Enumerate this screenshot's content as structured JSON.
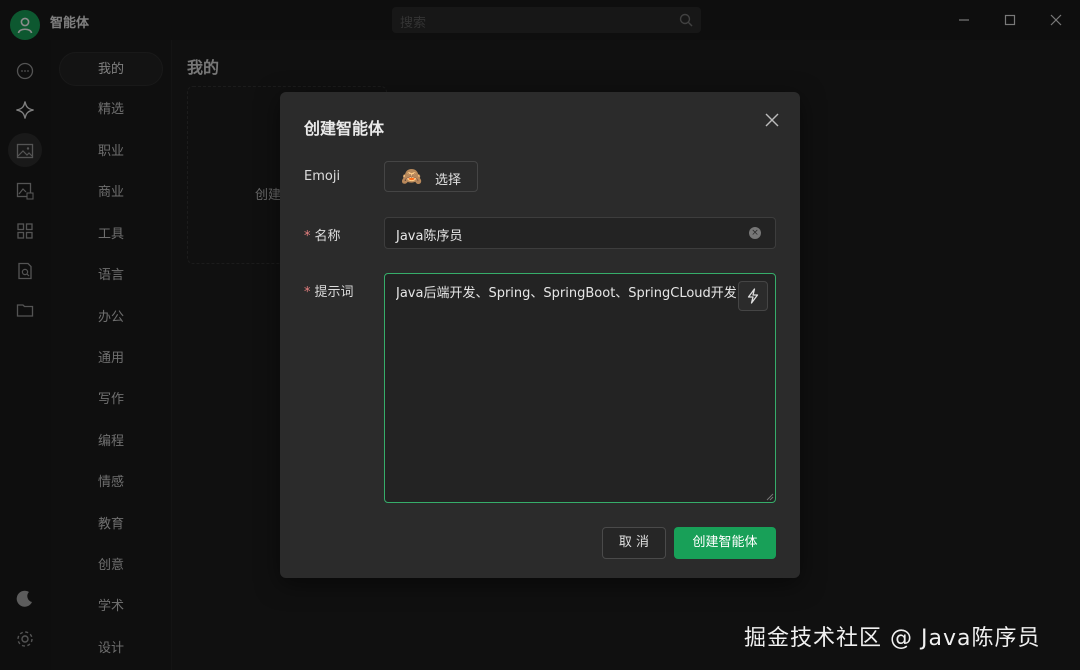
{
  "app": {
    "title": "智能体"
  },
  "search": {
    "placeholder": "搜索"
  },
  "left_nav": {
    "icons": [
      "chat-icon",
      "sparkle-icon",
      "image-icon",
      "image-edit-icon",
      "apps-icon",
      "document-search-icon",
      "folder-icon",
      "moon-icon",
      "gear-icon"
    ],
    "active": "sparkle-icon"
  },
  "categories": [
    "我的",
    "精选",
    "职业",
    "商业",
    "工具",
    "语言",
    "办公",
    "通用",
    "写作",
    "编程",
    "情感",
    "教育",
    "创意",
    "学术",
    "设计"
  ],
  "main": {
    "title": "我的",
    "card_text": "创建"
  },
  "modal": {
    "title": "创建智能体",
    "emoji_label": "Emoji",
    "emoji_value": "🙈",
    "emoji_button": "选择",
    "required_mark": "*",
    "name_label": "名称",
    "name_value": "Java陈序员",
    "prompt_label": "提示词",
    "prompt_value": "Java后端开发、Spring、SpringBoot、SpringCLoud开发",
    "cancel": "取 消",
    "create": "创建智能体"
  },
  "watermark": "掘金技术社区 @ Java陈序员",
  "colors": {
    "accent": "#18a058",
    "focus_border": "#36ad6a",
    "required": "#e88080"
  }
}
